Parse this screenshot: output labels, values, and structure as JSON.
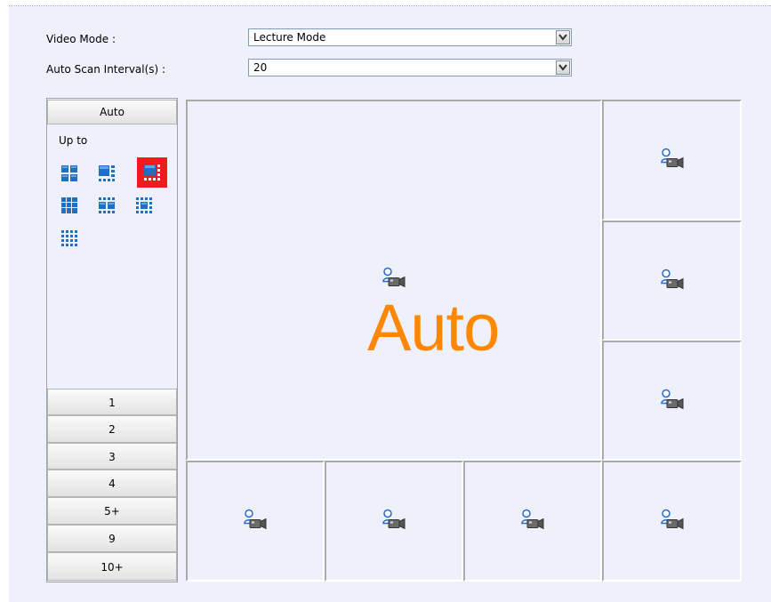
{
  "form": {
    "video_mode_label": "Video Mode :",
    "video_mode_value": "Lecture Mode",
    "scan_interval_label": "Auto Scan Interval(s) :",
    "scan_interval_value": "20"
  },
  "sidebar": {
    "auto_button": "Auto",
    "up_to_label": "Up to",
    "count_buttons": [
      "1",
      "2",
      "3",
      "4",
      "5+",
      "9",
      "10+"
    ]
  },
  "main": {
    "overlay_text": "Auto"
  },
  "colors": {
    "panel_bg": "#eef0fb",
    "auto_text": "#ff8800",
    "selected_layout": "#ee1c1c",
    "icon_blue": "#1f6fc2"
  },
  "icons": {
    "camera": "camera-icon",
    "dropdown": "chevron-down-icon"
  }
}
